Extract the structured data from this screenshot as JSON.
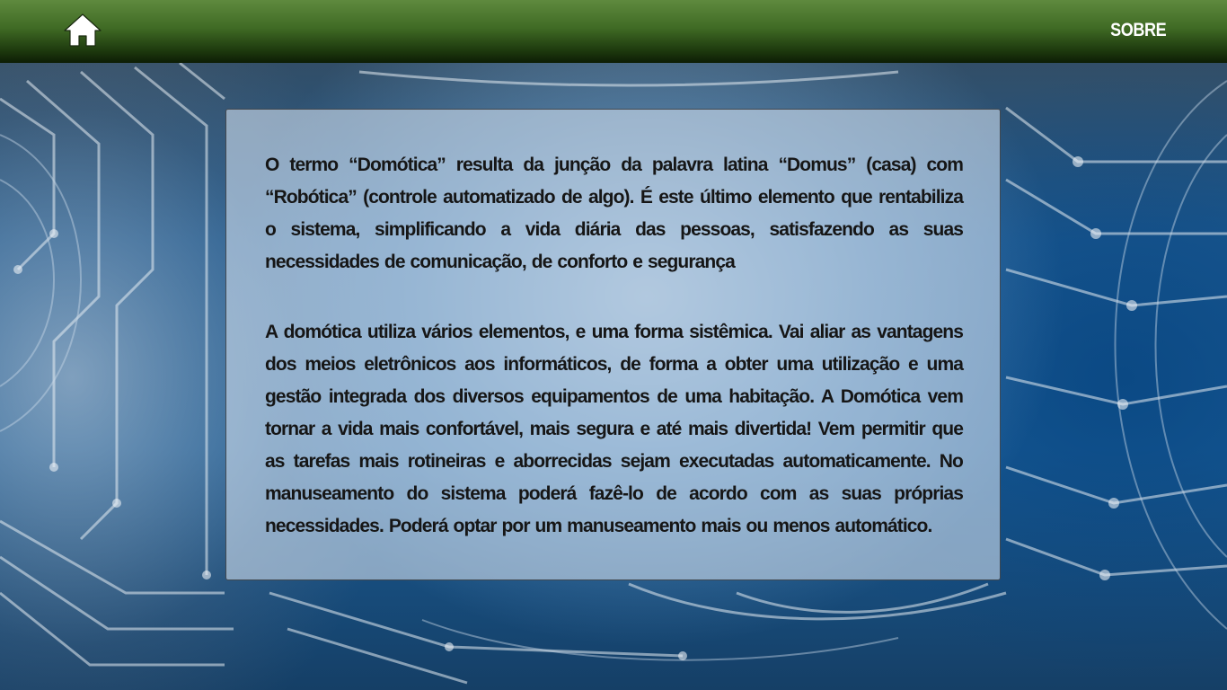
{
  "header": {
    "home_icon": "home-icon",
    "sobre_label": "SOBRE"
  },
  "content": {
    "paragraphs": [
      "O termo “Domótica” resulta da junção da palavra latina “Domus” (casa) com “Robótica” (controle automatizado de algo). É este último elemento que rentabiliza o sistema, simplificando a vida diária das pessoas, satisfazendo as suas necessidades de comunicação, de conforto e segurança",
      "A domótica utiliza vários elementos, e uma forma sistêmica. Vai aliar as vantagens dos meios eletrônicos aos informáticos, de forma a obter uma utilização e uma gestão integrada dos diversos equipamentos de uma habitação. A Domótica vem tornar a vida mais confortável, mais segura e até mais divertida! Vem permitir que as tarefas mais rotineiras e aborrecidas sejam executadas automaticamente. No manuseamento do sistema poderá fazê-lo de acordo com as suas próprias necessidades. Poderá optar por um manuseamento mais ou menos automático."
    ]
  },
  "colors": {
    "topbar": "#3f6a24",
    "background": "#1a5d98",
    "card": "#cddcec",
    "text": "#161616"
  }
}
